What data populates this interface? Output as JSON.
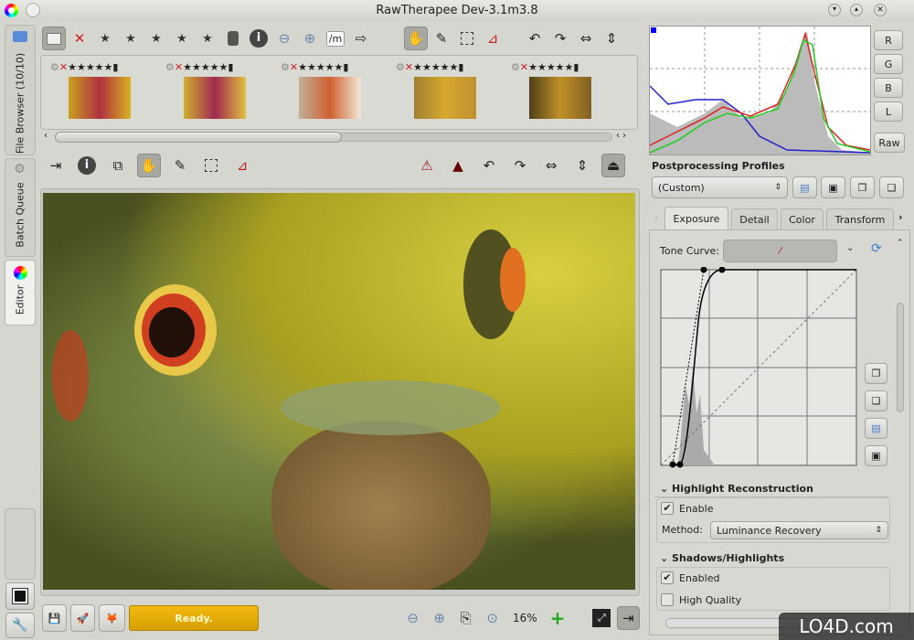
{
  "window": {
    "title": "RawTherapee Dev-3.1m3.8"
  },
  "side_tabs": [
    {
      "label": "File Browser (10/10)"
    },
    {
      "label": "Batch Queue"
    },
    {
      "label": "Editor"
    }
  ],
  "filmstrip": {
    "thumbnails": [
      {
        "colors": [
          "#c8a020",
          "#b03040",
          "#d8b020"
        ]
      },
      {
        "colors": [
          "#d0b030",
          "#a02850",
          "#e0c040"
        ]
      },
      {
        "colors": [
          "#c0b098",
          "#d06030",
          "#f0e8d8"
        ]
      },
      {
        "colors": [
          "#a08030",
          "#d8a830",
          "#c09030"
        ]
      },
      {
        "colors": [
          "#504018",
          "#c09028",
          "#806020"
        ]
      }
    ]
  },
  "top_toolbar": {
    "path_label": "/m"
  },
  "profiles": {
    "heading": "Postprocessing Profiles",
    "selected": "(Custom)"
  },
  "histogram": {
    "buttons": [
      "R",
      "G",
      "B",
      "L",
      "Raw"
    ]
  },
  "tabs": [
    "Exposure",
    "Detail",
    "Color",
    "Transform"
  ],
  "exposure": {
    "tone_curve_label": "Tone Curve:",
    "highlight": {
      "title": "Highlight Reconstruction",
      "enable_label": "Enable",
      "enable_checked": true,
      "method_label": "Method:",
      "method_value": "Luminance Recovery"
    },
    "shadows": {
      "title": "Shadows/Highlights",
      "enabled_label": "Enabled",
      "enabled_checked": true,
      "hq_label": "High Quality",
      "hq_checked": false
    }
  },
  "status": {
    "text": "Ready.",
    "zoom": "16%",
    "accent": "#e0aa10"
  },
  "watermark": "LO4D.com"
}
